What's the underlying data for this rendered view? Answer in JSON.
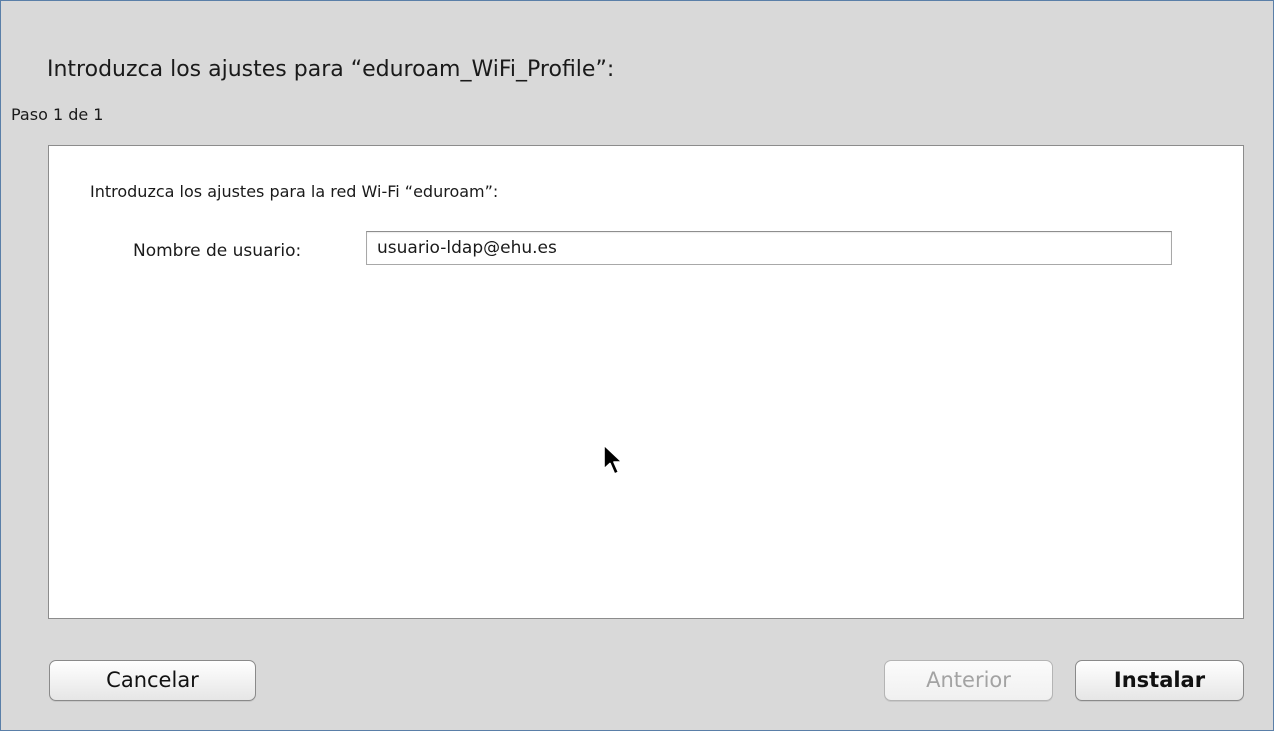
{
  "dialog": {
    "title": "Introduzca los ajustes para “eduroam_WiFi_Profile”:",
    "step": "Paso 1 de 1"
  },
  "panel": {
    "heading": "Introduzca los ajustes para la red Wi-Fi “eduroam”:",
    "username_label": "Nombre de usuario:",
    "username_value": "usuario-ldap@ehu.es"
  },
  "buttons": {
    "cancel": "Cancelar",
    "back": "Anterior",
    "install": "Instalar"
  },
  "icons": {
    "cursor": "arrow-cursor-icon"
  }
}
